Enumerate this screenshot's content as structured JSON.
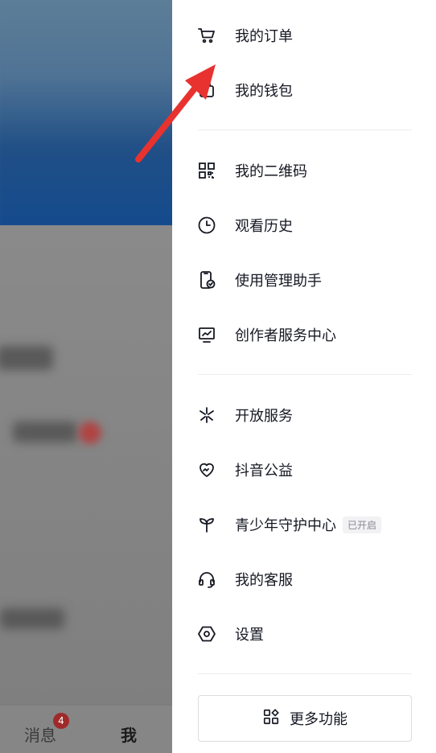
{
  "tabbar": {
    "messages_label": "消息",
    "messages_badge": "4",
    "me_label": "我"
  },
  "drawer": {
    "sections": [
      {
        "items": [
          {
            "label": "我的订单",
            "icon": "cart-icon"
          },
          {
            "label": "我的钱包",
            "icon": "wallet-icon"
          }
        ]
      },
      {
        "items": [
          {
            "label": "我的二维码",
            "icon": "qrcode-icon"
          },
          {
            "label": "观看历史",
            "icon": "clock-icon"
          },
          {
            "label": "使用管理助手",
            "icon": "phone-check-icon"
          },
          {
            "label": "创作者服务中心",
            "icon": "monitor-chart-icon"
          }
        ]
      },
      {
        "items": [
          {
            "label": "开放服务",
            "icon": "asterisk-icon"
          },
          {
            "label": "抖音公益",
            "icon": "heart-icon"
          },
          {
            "label": "青少年守护中心",
            "icon": "sprout-icon",
            "tag": "已开启"
          },
          {
            "label": "我的客服",
            "icon": "headset-icon"
          },
          {
            "label": "设置",
            "icon": "hexagon-gear-icon"
          }
        ]
      }
    ],
    "more_button_label": "更多功能"
  },
  "annotation": {
    "arrow_color": "#e8322f"
  },
  "colors": {
    "text": "#161823",
    "divider": "#ececec",
    "tag_bg": "#f2f2f4"
  }
}
